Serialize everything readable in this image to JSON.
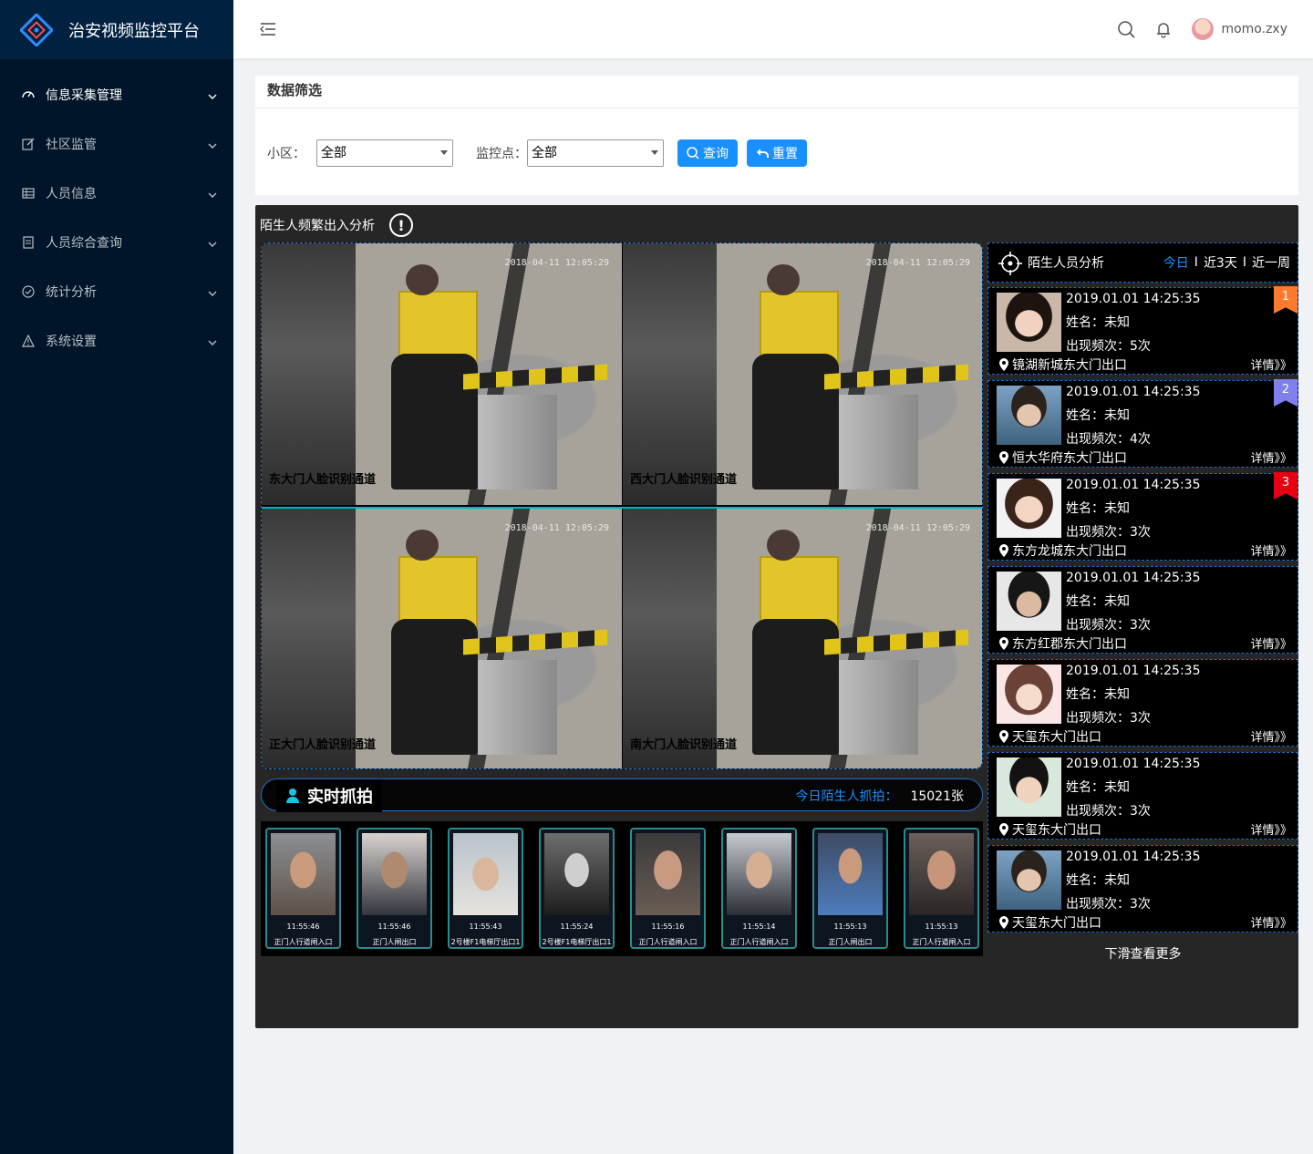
{
  "app": {
    "title": "治安视频监控平台"
  },
  "sidebar": {
    "items": [
      {
        "label": "信息采集管理",
        "icon": "dashboard-icon",
        "active": true
      },
      {
        "label": "社区监管",
        "icon": "edit-icon"
      },
      {
        "label": "人员信息",
        "icon": "table-icon"
      },
      {
        "label": "人员综合查询",
        "icon": "profile-icon"
      },
      {
        "label": "统计分析",
        "icon": "check-circle-icon"
      },
      {
        "label": "系统设置",
        "icon": "warning-icon"
      }
    ]
  },
  "header": {
    "username": "momo.zxy"
  },
  "filter": {
    "title": "数据筛选",
    "community_label": "小区：",
    "community_value": "全部",
    "monitor_label": "监控点：",
    "monitor_value": "全部",
    "query_label": "查询",
    "reset_label": "重置"
  },
  "panel": {
    "title": "陌生人频繁出入分析",
    "videos": [
      {
        "label": "东大门人脸识别通道",
        "timestamp": "2018-04-11 12:05:29"
      },
      {
        "label": "西大门人脸识别通道",
        "timestamp": "2018-04-11 12:05:29"
      },
      {
        "label": "正大门人脸识别通道",
        "timestamp": "2018-04-11 12:05:29"
      },
      {
        "label": "南大门人脸识别通道",
        "timestamp": "2018-04-11 12:05:29"
      }
    ],
    "realtime": {
      "title": "实时抓拍",
      "count_label": "今日陌生人抓拍：",
      "count_value": "15021张"
    },
    "snapshots": [
      {
        "time": "11:55:46",
        "location": "正门人行道闸入口"
      },
      {
        "time": "11:55:46",
        "location": "正门人闸出口"
      },
      {
        "time": "11:55:43",
        "location": "2号楼F1电梯厅出口1"
      },
      {
        "time": "11:55:24",
        "location": "2号楼F1电梯厅出口1"
      },
      {
        "time": "11:55:16",
        "location": "正门人行道闸入口"
      },
      {
        "time": "11:55:14",
        "location": "正门人行道闸入口"
      },
      {
        "time": "11:55:13",
        "location": "正门人闸出口"
      },
      {
        "time": "11:55:13",
        "location": "正门人行道闸入口"
      }
    ]
  },
  "analysis": {
    "title": "陌生人员分析",
    "tabs": [
      {
        "label": "今日",
        "active": true
      },
      {
        "label": "近3天"
      },
      {
        "label": "近一周"
      }
    ],
    "separator": "I",
    "people": [
      {
        "datetime": "2019.01.01 14:25:35",
        "name": "姓名：未知",
        "freq": "出现频次：5次",
        "location": "镜湖新城东大门出口",
        "detail": "详情》》",
        "rank": "1",
        "rank_color": "#ff7a2e"
      },
      {
        "datetime": "2019.01.01 14:25:35",
        "name": "姓名：未知",
        "freq": "出现频次：4次",
        "location": "恒大华府东大门出口",
        "detail": "详情》》",
        "rank": "2",
        "rank_color": "#7f7ff0"
      },
      {
        "datetime": "2019.01.01 14:25:35",
        "name": "姓名：未知",
        "freq": "出现频次：3次",
        "location": "东方龙城东大门出口",
        "detail": "详情》》",
        "rank": "3",
        "rank_color": "#e60012"
      },
      {
        "datetime": "2019.01.01 14:25:35",
        "name": "姓名：未知",
        "freq": "出现频次：3次",
        "location": "东方红郡东大门出口",
        "detail": "详情》》"
      },
      {
        "datetime": "2019.01.01 14:25:35",
        "name": "姓名：未知",
        "freq": "出现频次：3次",
        "location": "天玺东大门出口",
        "detail": "详情》》"
      },
      {
        "datetime": "2019.01.01 14:25:35",
        "name": "姓名：未知",
        "freq": "出现频次：3次",
        "location": "天玺东大门出口",
        "detail": "详情》》"
      },
      {
        "datetime": "2019.01.01 14:25:35",
        "name": "姓名：未知",
        "freq": "出现频次：3次",
        "location": "天玺东大门出口",
        "detail": "详情》》"
      }
    ],
    "more_label": "下滑查看更多"
  }
}
